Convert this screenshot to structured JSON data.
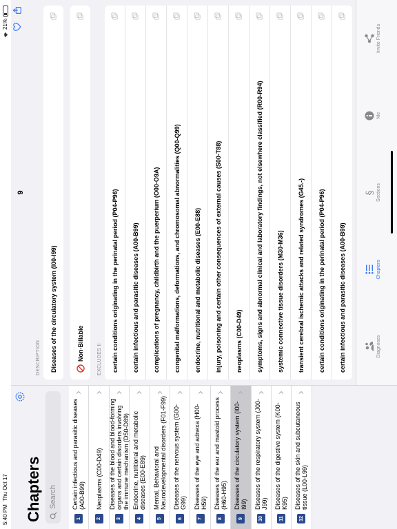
{
  "status": {
    "time": "5:40 PM",
    "date": "Thu Oct 17",
    "battery": "21%"
  },
  "sidebar": {
    "title": "Chapters",
    "search_placeholder": "Search",
    "chapters": [
      {
        "num": "1",
        "label": "Certain infectious and parasitic diseases (A00-B99)"
      },
      {
        "num": "2",
        "label": "Neoplasms (C00-D49)"
      },
      {
        "num": "3",
        "label": "Diseases of the blood and blood-forming organs and certain disorders involving the immune mechanism (D50-D89)"
      },
      {
        "num": "4",
        "label": "Endocrine, nutritional and metabolic diseases (E00-E89)"
      },
      {
        "num": "5",
        "label": "Mental, Behavioral and Neurodevelopmental disorders (F01-F99)"
      },
      {
        "num": "6",
        "label": "Diseases of the nervous system (G00-G99)"
      },
      {
        "num": "7",
        "label": "Diseases of the eye and adnexa (H00-H59)"
      },
      {
        "num": "8",
        "label": "Diseases of the ear and mastoid process (H60-H95)"
      },
      {
        "num": "9",
        "label": "Diseases of the circulatory system (I00-I99)"
      },
      {
        "num": "10",
        "label": "Diseases of the respiratory system (J00-J99)"
      },
      {
        "num": "11",
        "label": "Diseases of the digestive system (K00-K95)"
      },
      {
        "num": "12",
        "label": "Diseases of the skin and subcutaneous tissue (L00-L99)"
      }
    ]
  },
  "main": {
    "title": "9",
    "description_header": "DESCRIPTION",
    "description": "Diseases of the circulatory system (I00-I99)",
    "billing": "Non-Billable",
    "excludes_header": "EXCLUDES II",
    "excludes": [
      "certain conditions originating in the perinatal period (P04-P96)",
      "certain infectious and parasitic diseases (A00-B99)",
      "complications of pregnancy, childbirth and the puerperium (O00-O9A)",
      "congenital malformations, deformations, and chromosomal abnormalities (Q00-Q99)",
      "endocrine, nutritional and metabolic diseases (E00-E88)",
      "injury, poisoning and certain other consequences of external causes (S00-T88)",
      "neoplasms (C00-D49)",
      "symptoms, signs and abnormal clinical and laboratory findings, not elsewhere classified (R00-R94)",
      "systemic connective tissue disorders (M30-M36)",
      "transient cerebral ischemic attacks and related syndromes (G45.-)",
      "certain conditions originating in the perinatal period (P04-P96)",
      "certain infectious and parasitic diseases (A00-B99)"
    ]
  },
  "tabs": [
    {
      "label": "Diagnoses",
      "icon": "person-icon"
    },
    {
      "label": "Chapters",
      "icon": "list-icon"
    },
    {
      "label": "Sections",
      "icon": "section-icon"
    },
    {
      "label": "Me",
      "icon": "info-icon"
    },
    {
      "label": "Invite Friends",
      "icon": "share-icon"
    }
  ],
  "colors": {
    "accent": "#3478f6",
    "badge": "#2c4b8f",
    "nonbillable": "#d83b2f"
  }
}
